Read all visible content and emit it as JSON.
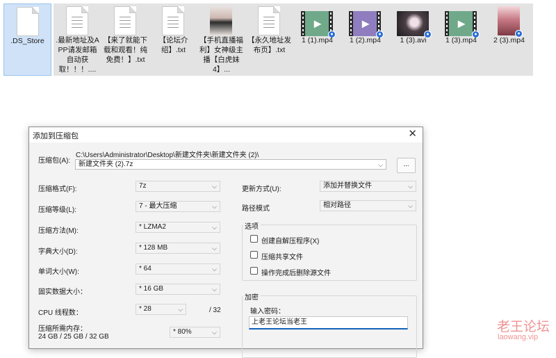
{
  "files": [
    {
      "name": ".DS_Store",
      "icon": "document-icon"
    },
    {
      "name": ".最新地址及APP请发邮箱自动获取！！！....",
      "icon": "document-icon"
    },
    {
      "name": "【来了就能下载和观看！纯免费！】.txt",
      "icon": "document-icon"
    },
    {
      "name": "【论坛介绍】.txt",
      "icon": "document-icon"
    },
    {
      "name": "【手机直播福利】女神级主播【白虎妹4】...",
      "icon": "image-thumbnail"
    },
    {
      "name": "【永久地址发布页】.txt",
      "icon": "document-icon"
    },
    {
      "name": "1 (1).mp4",
      "icon": "video-icon"
    },
    {
      "name": "1 (2).mp4",
      "icon": "video-icon"
    },
    {
      "name": "1 (3).avi",
      "icon": "video-thumbnail"
    },
    {
      "name": "1 (3).mp4",
      "icon": "video-icon"
    },
    {
      "name": "2 (3).mp4",
      "icon": "video-thumbnail"
    }
  ],
  "dialog": {
    "title": "添加到压缩包",
    "archive_label": "压缩包(A):",
    "archive_path": "C:\\Users\\Administrator\\Desktop\\新建文件夹\\新建文件夹 (2)\\",
    "archive_name": "新建文件夹 (2).7z",
    "browse_label": "...",
    "format_label": "压缩格式(F):",
    "format_value": "7z",
    "level_label": "压缩等级(L):",
    "level_value": "7 - 最大压缩",
    "method_label": "压缩方法(M):",
    "method_value": "*  LZMA2",
    "dict_label": "字典大小(D):",
    "dict_value": "*  128 MB",
    "word_label": "单词大小(W):",
    "word_value": "*  64",
    "solid_label": "固实数据大小：",
    "solid_value": "*  16 GB",
    "cpu_label": "CPU 线程数：",
    "cpu_value": "*  28",
    "cpu_total": "/ 32",
    "mem_label": "压缩所需内存：",
    "mem_value": "24 GB / 25 GB / 32 GB",
    "mem_percent": "*  80%",
    "update_label": "更新方式(U):",
    "update_value": "添加并替换文件",
    "pathmode_label": "路径模式",
    "pathmode_value": "相对路径",
    "options_title": "选项",
    "opt_sfx": "创建自解压程序(X)",
    "opt_shared": "压缩共享文件",
    "opt_delete": "操作完成后删除源文件",
    "encrypt_title": "加密",
    "password_label": "输入密码：",
    "password_value": "上老王论坛当老王"
  },
  "watermark": {
    "text": "老王论坛",
    "url": "laowang.vip"
  }
}
